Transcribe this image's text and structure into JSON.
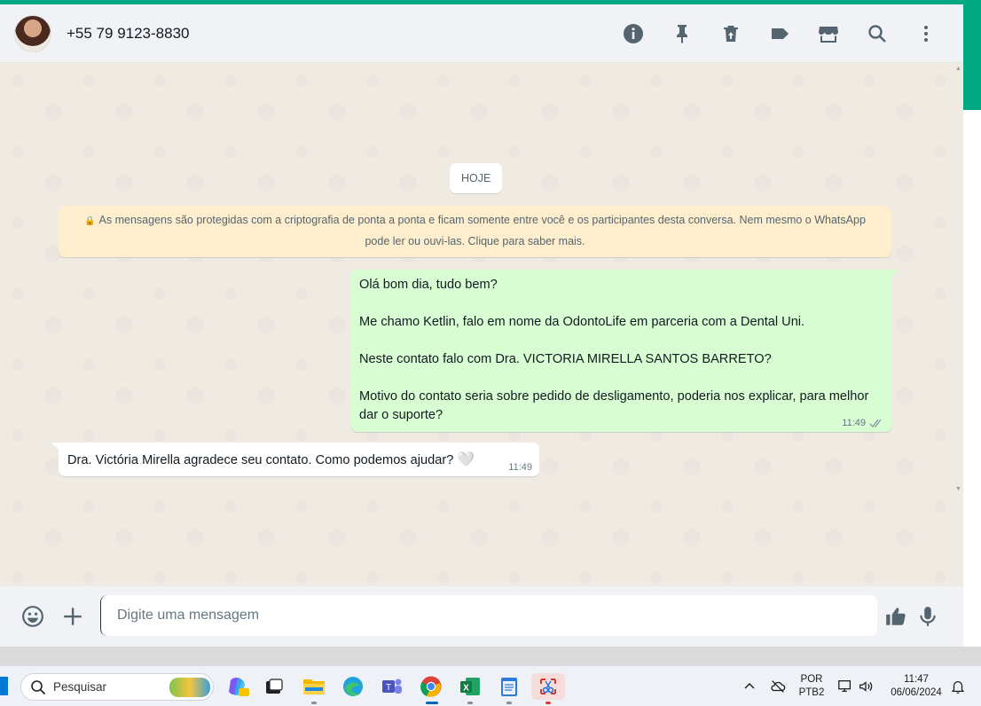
{
  "header": {
    "contact_name": "+55 79 9123-8830",
    "icons": [
      "info-icon",
      "pin-icon",
      "delete-icon",
      "label-icon",
      "catalog-icon",
      "search-icon",
      "menu-icon"
    ]
  },
  "chat": {
    "date_label": "HOJE",
    "encryption_notice": "As mensagens são protegidas com a criptografia de ponta a ponta e ficam somente entre você e os participantes desta conversa. Nem mesmo o WhatsApp pode ler ou ouvi-las. Clique para saber mais.",
    "outgoing": {
      "lines": [
        "Olá bom dia, tudo bem?",
        "Me chamo Ketlin, falo em nome da OdontoLife em parceria com a Dental Uni.",
        "Neste contato falo com Dra. VICTORIA MIRELLA SANTOS BARRETO?",
        "Motivo do contato seria sobre pedido de desligamento, poderia nos explicar, para melhor dar o suporte?"
      ],
      "time": "11:49",
      "status": "read"
    },
    "incoming": {
      "text": "Dra. Victória Mirella agradece seu contato. Como podemos ajudar?",
      "emoji": "🤍",
      "time": "11:49"
    }
  },
  "composer": {
    "placeholder": "Digite uma mensagem",
    "value": ""
  },
  "taskbar": {
    "search_label": "Pesquisar",
    "language_line1": "POR",
    "language_line2": "PTB2",
    "time": "11:47",
    "date": "06/06/2024",
    "apps": [
      "copilot",
      "task-view",
      "file-explorer",
      "edge",
      "teams",
      "chrome",
      "excel",
      "notepad",
      "snipping-tool"
    ]
  },
  "colors": {
    "accent": "#00a884",
    "outgoing_bubble": "#d9fdd3",
    "incoming_bubble": "#ffffff",
    "notice_bubble": "#ffeecd",
    "chat_bg": "#efeae2",
    "header_bg": "#f0f2f5"
  }
}
